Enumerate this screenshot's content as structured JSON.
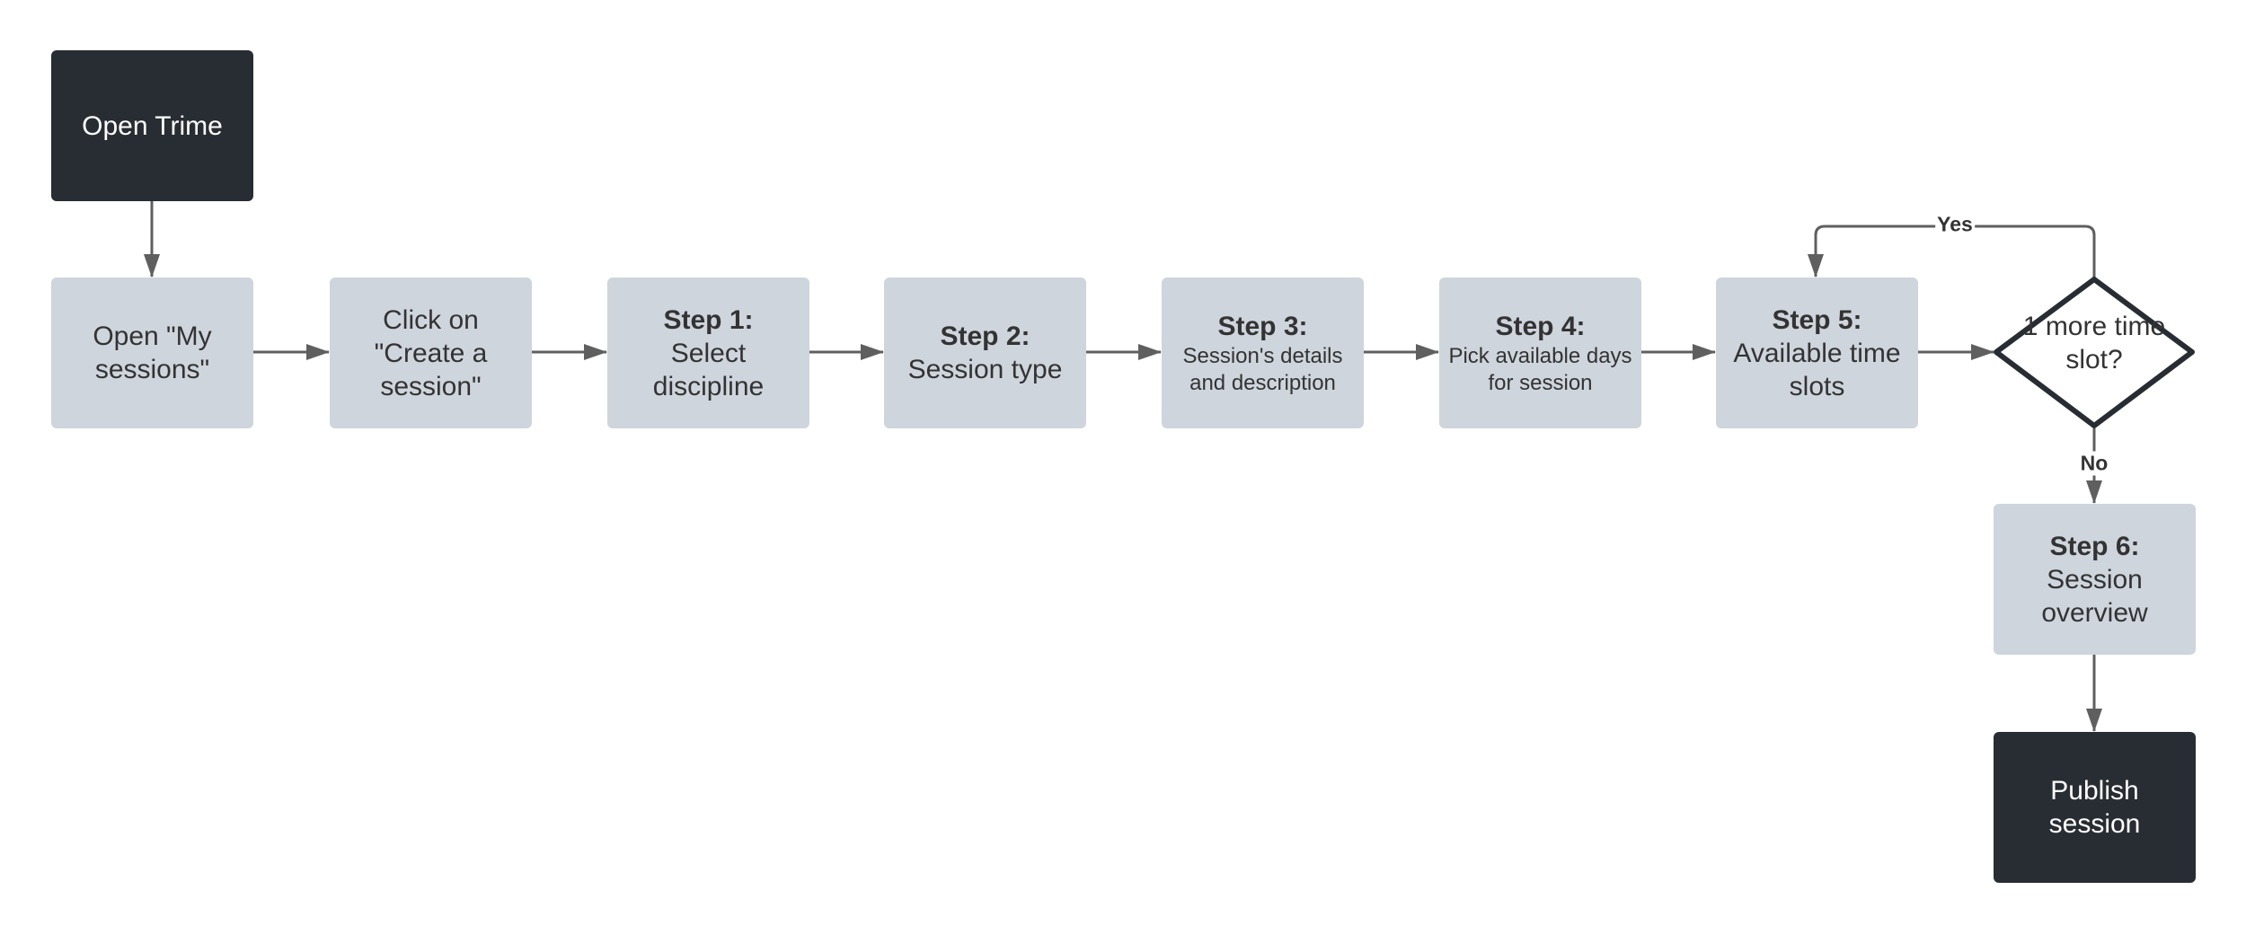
{
  "colors": {
    "terminal": "#282c33",
    "process": "#cfd5dd",
    "connector": "#5f5f5f",
    "decision_border": "#282c33"
  },
  "nodes": {
    "start": {
      "text": "Open Trime"
    },
    "my_sessions": {
      "text": "Open \"My sessions\""
    },
    "create": {
      "text": "Click on \"Create a session\""
    },
    "step1": {
      "title": "Step 1:",
      "text": "Select discipline"
    },
    "step2": {
      "title": "Step 2:",
      "text": "Session type"
    },
    "step3": {
      "title": "Step 3:",
      "text": "Session's details and description"
    },
    "step4": {
      "title": "Step 4:",
      "text": "Pick available days for session"
    },
    "step5": {
      "title": "Step 5:",
      "text": "Available time slots"
    },
    "decision": {
      "text": "1 more time slot?"
    },
    "step6": {
      "title": "Step 6:",
      "text": "Session overview"
    },
    "end": {
      "text": "Publish session"
    }
  },
  "edges": {
    "yes_label": "Yes",
    "no_label": "No"
  }
}
